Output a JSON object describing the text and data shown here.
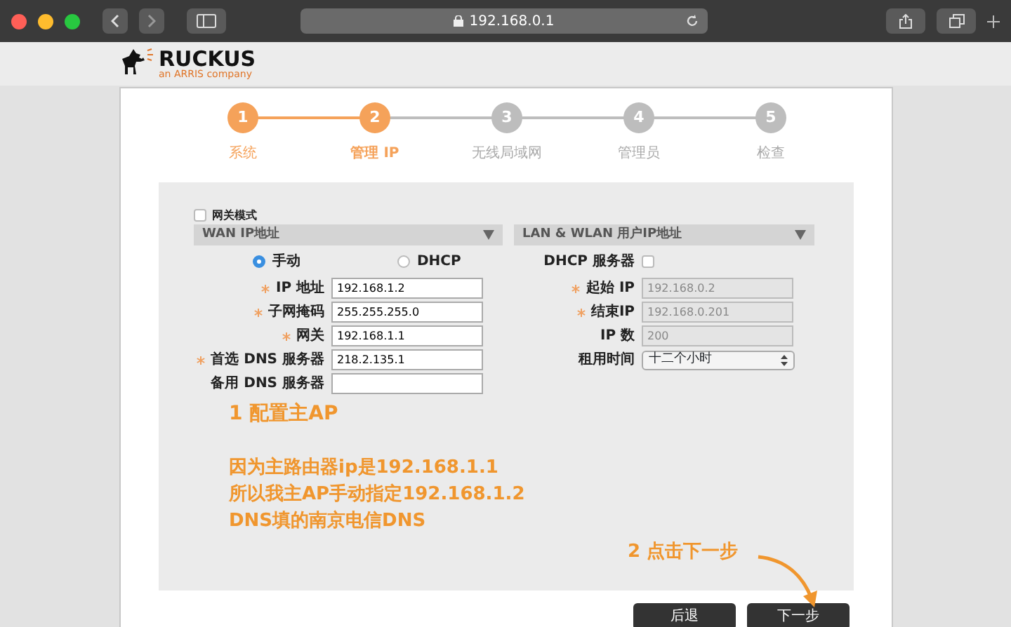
{
  "browser": {
    "url": "192.168.0.1"
  },
  "logo": {
    "name": "RUCKUS",
    "tagline": "an ARRIS company"
  },
  "steps": [
    {
      "number": "1",
      "label": "系统",
      "completed": true,
      "selected": false
    },
    {
      "number": "2",
      "label": "管理 IP",
      "completed": false,
      "selected": true
    },
    {
      "number": "3",
      "label": "无线局域网",
      "completed": false,
      "selected": false
    },
    {
      "number": "4",
      "label": "管理员",
      "completed": false,
      "selected": false
    },
    {
      "number": "5",
      "label": "检查",
      "completed": false,
      "selected": false
    }
  ],
  "gateway_mode": {
    "label": "网关模式",
    "checked": false
  },
  "wan": {
    "header": "WAN IP地址",
    "modes": [
      {
        "label": "手动",
        "selected": true
      },
      {
        "label": "DHCP",
        "selected": false
      }
    ],
    "fields": [
      {
        "label": "IP 地址",
        "required": true,
        "value": "192.168.1.2"
      },
      {
        "label": "子网掩码",
        "required": true,
        "value": "255.255.255.0"
      },
      {
        "label": "网关",
        "required": true,
        "value": "192.168.1.1"
      },
      {
        "label": "首选 DNS 服务器",
        "required": true,
        "value": "218.2.135.1"
      },
      {
        "label": "备用 DNS 服务器",
        "required": false
      }
    ]
  },
  "lan": {
    "header": "LAN & WLAN 用户IP地址",
    "dhcp_server": {
      "label": "DHCP 服务器",
      "checked": false
    },
    "fields": [
      {
        "label": "起始 IP",
        "required": true,
        "value": "192.168.0.2",
        "disabled": true
      },
      {
        "label": "结束IP",
        "required": true,
        "value": "192.168.0.201",
        "disabled": true
      },
      {
        "label": "IP 数",
        "required": false,
        "value": "200",
        "disabled": true
      }
    ],
    "lease": {
      "label": "租用时间",
      "value": "十二个小时"
    }
  },
  "annotations": {
    "note": [
      "1 配置主AP",
      "因为主路由器ip是192.168.1.1",
      "所以我主AP手动指定192.168.1.2",
      "DNS填的南京电信DNS"
    ],
    "hint": "2 点击下一步"
  },
  "buttons": [
    {
      "label": "后退"
    },
    {
      "label": "下一步"
    }
  ]
}
